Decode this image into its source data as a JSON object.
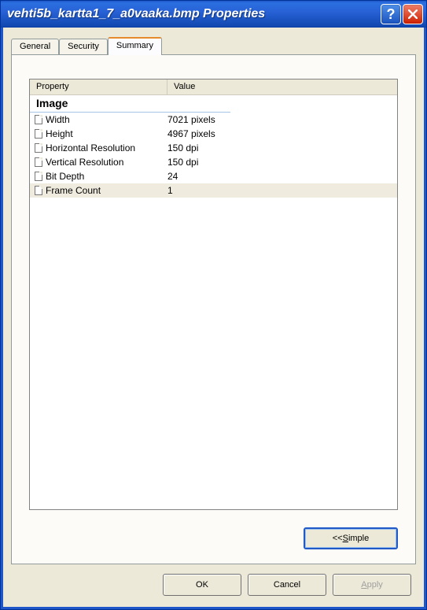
{
  "window": {
    "title": "vehti5b_kartta1_7_a0vaaka.bmp Properties"
  },
  "tabs": {
    "general": "General",
    "security": "Security",
    "summary": "Summary"
  },
  "listHeader": {
    "property": "Property",
    "value": "Value"
  },
  "group": "Image",
  "props": {
    "width": {
      "name": "Width",
      "value": "7021 pixels"
    },
    "height": {
      "name": "Height",
      "value": "4967 pixels"
    },
    "hres": {
      "name": "Horizontal Resolution",
      "value": "150 dpi"
    },
    "vres": {
      "name": "Vertical Resolution",
      "value": "150 dpi"
    },
    "bitdepth": {
      "name": "Bit Depth",
      "value": "24"
    },
    "framecnt": {
      "name": "Frame Count",
      "value": "1"
    }
  },
  "buttons": {
    "simple_prefix": "<< ",
    "simple_letter": "S",
    "simple_rest": "imple",
    "ok": "OK",
    "cancel": "Cancel",
    "apply_letter": "A",
    "apply_rest": "pply"
  }
}
